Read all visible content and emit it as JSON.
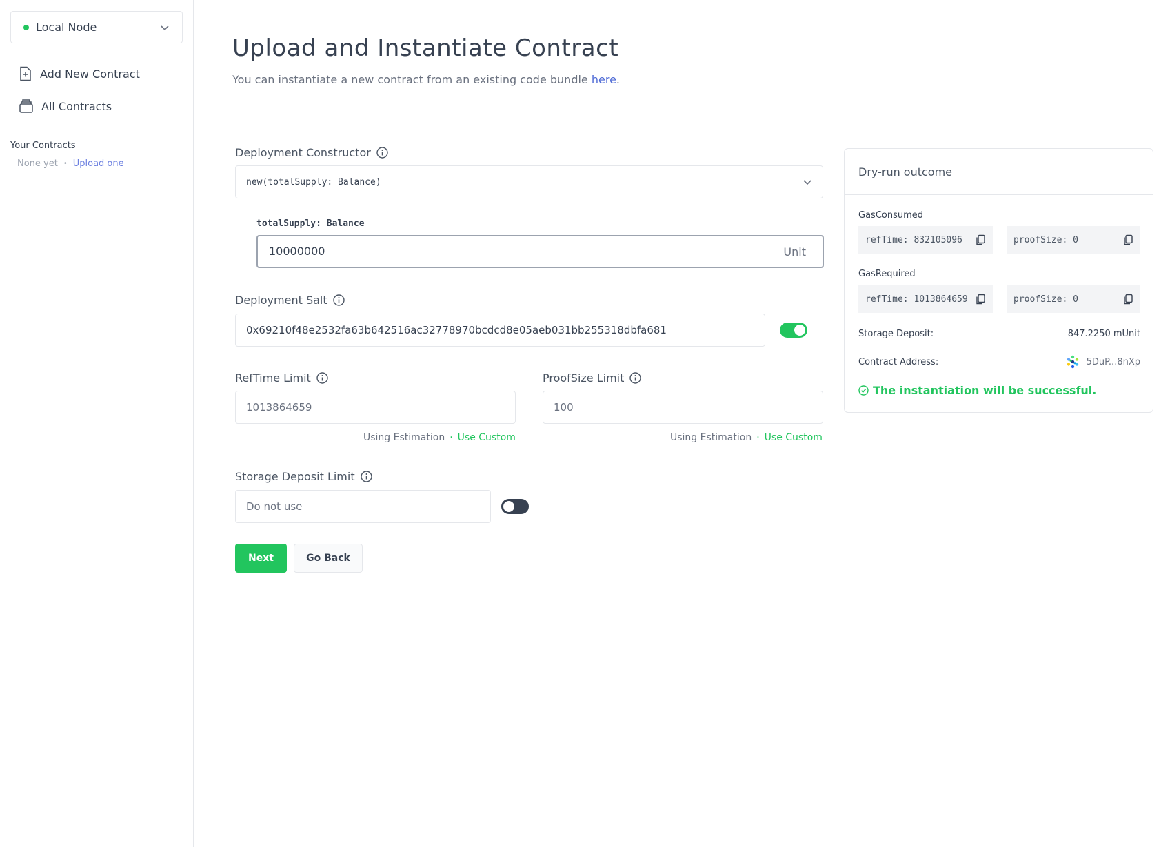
{
  "sidebar": {
    "node": "Local Node",
    "nav": [
      {
        "label": "Add New Contract"
      },
      {
        "label": "All Contracts"
      }
    ],
    "your_contracts": "Your Contracts",
    "none_yet": "None yet",
    "upload_one": "Upload one"
  },
  "header": {
    "title": "Upload and Instantiate Contract",
    "subtitle": "You can instantiate a new contract from an existing code bundle",
    "subtitle_link": "here",
    "subtitle_end": "."
  },
  "form": {
    "constructor_label": "Deployment Constructor",
    "constructor_value": "new(totalSupply: Balance)",
    "arg_label": "totalSupply: Balance",
    "arg_value": "10000000",
    "arg_unit": "Unit",
    "salt_label": "Deployment Salt",
    "salt_value": "0x69210f48e2532fa63b642516ac32778970bcdcd8e05aeb031bb255318dbfa681",
    "reftime_label": "RefTime Limit",
    "reftime_value": "1013864659",
    "proofsize_label": "ProofSize Limit",
    "proofsize_value": "100",
    "using_estimation": "Using Estimation",
    "dot": "·",
    "use_custom": "Use Custom",
    "storage_label": "Storage Deposit Limit",
    "storage_value": "Do not use",
    "next": "Next",
    "go_back": "Go Back"
  },
  "dry_run": {
    "title": "Dry-run outcome",
    "gas_consumed_label": "GasConsumed",
    "gas_consumed_reftime": "refTime: 832105096",
    "gas_consumed_proofsize": "proofSize: 0",
    "gas_required_label": "GasRequired",
    "gas_required_reftime": "refTime: 1013864659",
    "gas_required_proofsize": "proofSize: 0",
    "storage_deposit_label": "Storage Deposit:",
    "storage_deposit_value": "847.2250 mUnit",
    "contract_address_label": "Contract Address:",
    "contract_address_value": "5DuP...8nXp",
    "success": "The instantiation will be successful."
  },
  "colors": {
    "accent": "#22c55e",
    "link": "#4f6bd6"
  }
}
